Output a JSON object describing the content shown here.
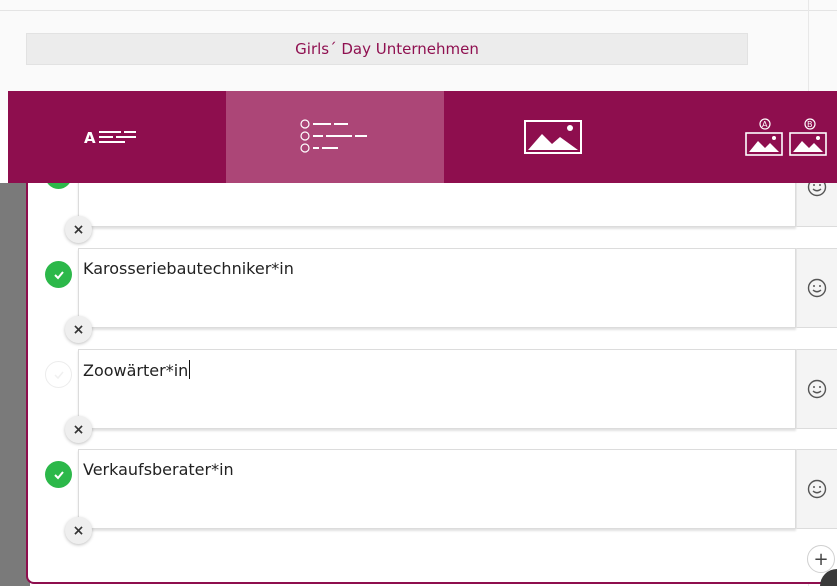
{
  "header": {
    "title": "Girls´ Day Unternehmen"
  },
  "toolbar": {
    "tabs": [
      {
        "icon": "text-lines-icon",
        "active": false
      },
      {
        "icon": "abc-list-icon",
        "active": true
      },
      {
        "icon": "image-icon",
        "active": false
      },
      {
        "icon": "image-ab-icon",
        "active": false
      }
    ],
    "colors": {
      "bar": "#8e0e4e",
      "active": "#ac4677"
    }
  },
  "answers": [
    {
      "text": "",
      "checked": true
    },
    {
      "text": "Karosseriebautechniker*in",
      "checked": true
    },
    {
      "text": "Zoowärter*in",
      "checked": false,
      "focused": true
    },
    {
      "text": "Verkaufsberater*in",
      "checked": true
    }
  ],
  "controls": {
    "delete_symbol": "×",
    "add_symbol": "+",
    "emoji_icon": "smiley-icon"
  }
}
